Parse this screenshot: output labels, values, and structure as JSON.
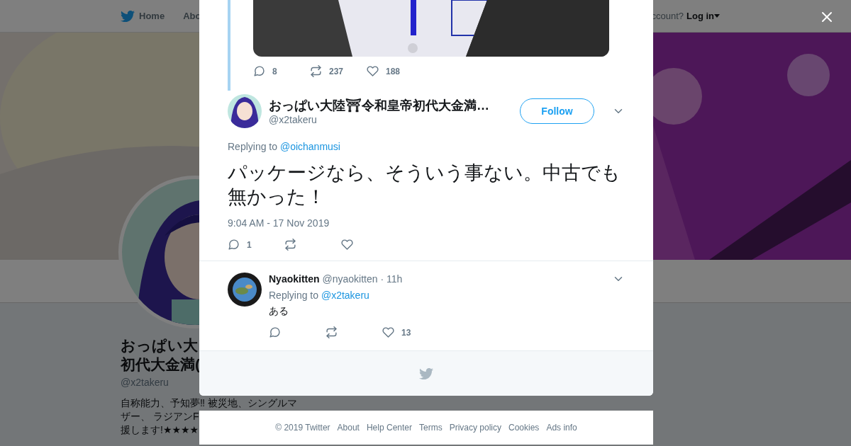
{
  "nav": {
    "items": [
      {
        "label": "Home",
        "selected": false
      },
      {
        "label": "Abo",
        "selected": false
      }
    ],
    "account_prompt": "ccount?",
    "login": "Log in"
  },
  "profile": {
    "name_lines": [
      "おっぱい大",
      "初代大金満("
    ],
    "handle": "@x2takeru",
    "bio_lines": [
      "自称能力、予知夢‼ 被災地、シングルマ",
      "ザー、 ラジアンF",
      "援します!★★★★"
    ]
  },
  "thread": {
    "previous_tweet": {
      "kind": "picture",
      "replies": "8",
      "retweets": "237",
      "likes": "188"
    },
    "main_tweet": {
      "name": "おっぱい大陸⛩令和皇帝初代大金満…",
      "handle": "@x2takeru",
      "follow": "Follow",
      "replying_label": "Replying to",
      "replying_to": "@oichanmusi",
      "text": "パッケージなら、そういう事ない。中古でも無かった！",
      "timestamp": "9:04 AM - 17 Nov 2019",
      "replies": "1"
    },
    "replies": [
      {
        "name": "Nyaokitten",
        "handle": "@nyaokitten",
        "time": "· 11h",
        "replying_label": "Replying to",
        "replying_to": "@x2takeru",
        "text": "ある",
        "likes": "13"
      }
    ]
  },
  "footer_links": [
    "© 2019 Twitter",
    "About",
    "Help Center",
    "Terms",
    "Privacy policy",
    "Cookies",
    "Ads info"
  ]
}
